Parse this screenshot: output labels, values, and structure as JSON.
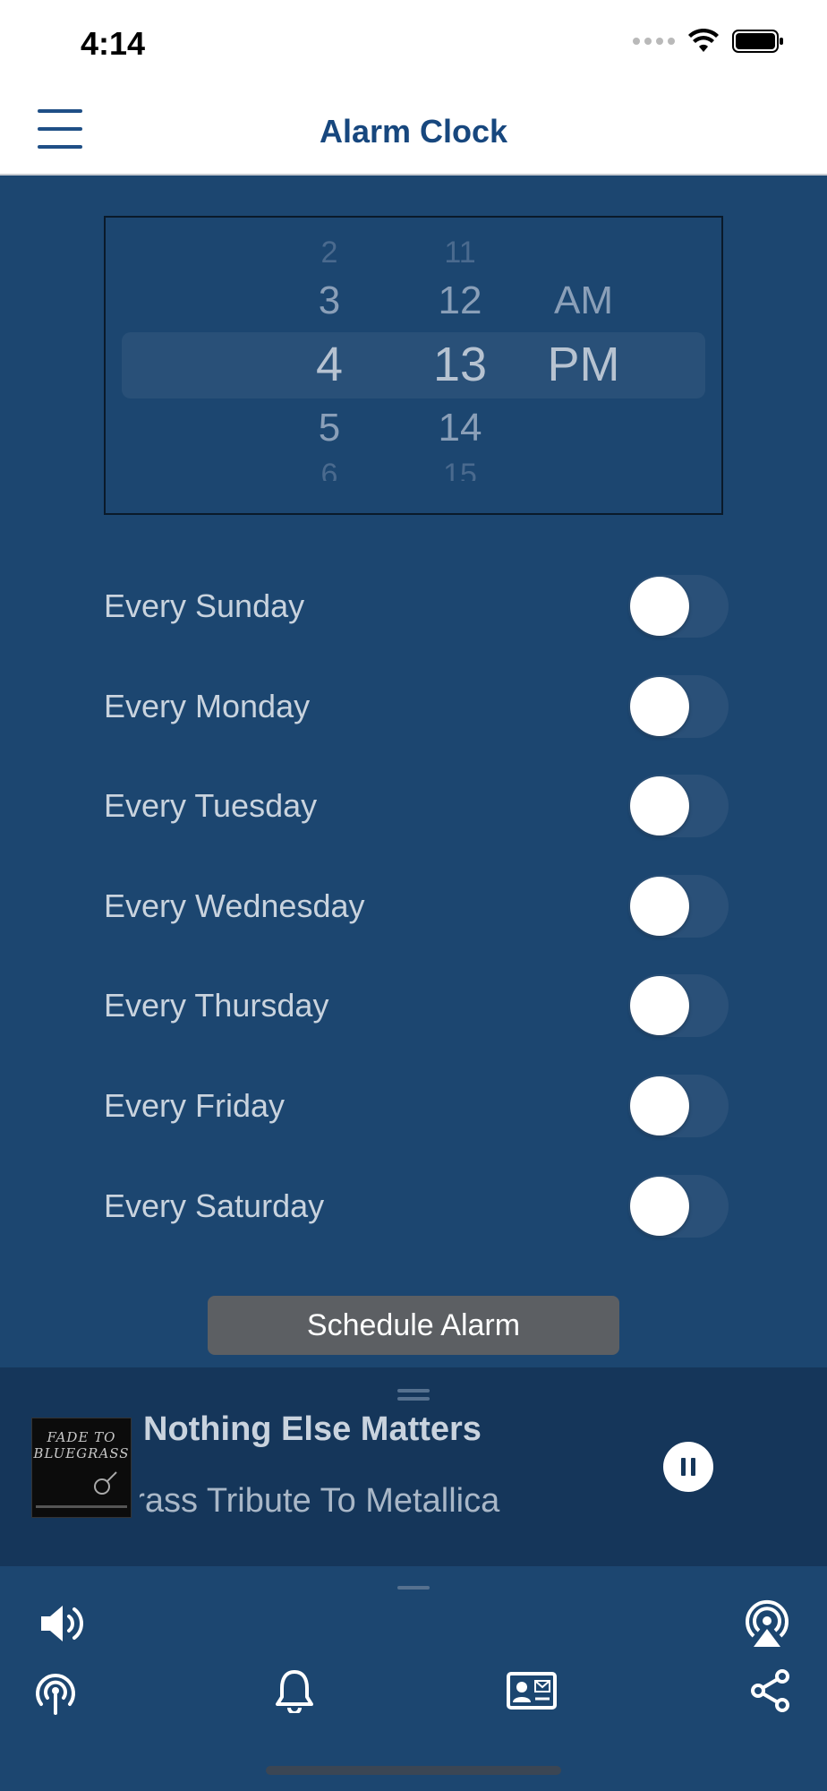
{
  "status_bar": {
    "time": "4:14"
  },
  "nav": {
    "title": "Alarm Clock",
    "menu_icon": "hamburger-menu-icon"
  },
  "time_picker": {
    "hours": [
      "2",
      "3",
      "4",
      "5",
      "6"
    ],
    "minutes": [
      "11",
      "12",
      "13",
      "14",
      "15"
    ],
    "periods": [
      "AM",
      "PM"
    ],
    "selected": {
      "hour": "4",
      "minute": "13",
      "period": "PM"
    }
  },
  "days": [
    {
      "label": "Every Sunday",
      "enabled": false
    },
    {
      "label": "Every Monday",
      "enabled": false
    },
    {
      "label": "Every Tuesday",
      "enabled": false
    },
    {
      "label": "Every Wednesday",
      "enabled": false
    },
    {
      "label": "Every Thursday",
      "enabled": false
    },
    {
      "label": "Every Friday",
      "enabled": false
    },
    {
      "label": "Every Saturday",
      "enabled": false
    }
  ],
  "schedule_button": {
    "label": "Schedule Alarm"
  },
  "player": {
    "track_title": "Nothing Else Matters",
    "album": "Bluegrass Tribute To Metallica",
    "album_art_text": [
      "FADE TO",
      "BLUEGRASS"
    ],
    "state": "playing"
  },
  "bottom_icons": [
    "volume-icon",
    "airplay-icon",
    "podcast-icon",
    "bell-icon",
    "contact-card-icon",
    "share-icon"
  ],
  "colors": {
    "background": "#1c4670",
    "player": "#15365a",
    "accent": "#17477e"
  }
}
